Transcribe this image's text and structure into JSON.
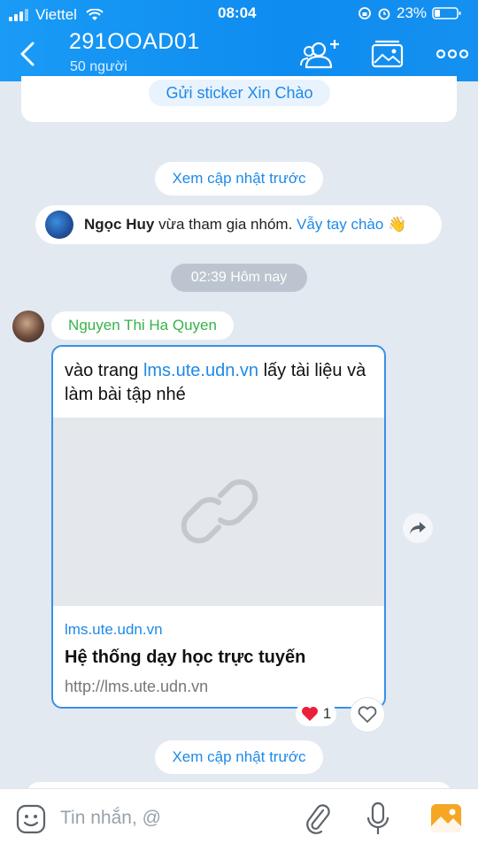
{
  "status_bar": {
    "carrier": "Viettel",
    "time": "08:04",
    "battery": "23%"
  },
  "header": {
    "group_name": "291OOAD01",
    "member_count": "50 người",
    "accent_color": "#0e8cf0"
  },
  "chat": {
    "sticker_button": "Gửi sticker Xin Chào",
    "load_more_top": "Xem cập nhật trước",
    "join_notice": {
      "name": "Ngọc Huy",
      "action": "vừa tham gia nhóm.",
      "wave_label": "Vẫy tay chào",
      "emoji": "👋"
    },
    "time_divider": "02:39 Hôm nay",
    "message": {
      "sender": "Nguyen Thi Ha Quyen",
      "text_before": "vào trang",
      "link_text": "lms.ute.udn.vn",
      "text_after": "lấy tài liệu và làm bài tập nhé",
      "preview": {
        "domain": "lms.ute.udn.vn",
        "title": "Hệ thống dạy học trực tuyến",
        "url": "http://lms.ute.udn.vn"
      },
      "reaction": {
        "emoji": "❤️",
        "count": "1"
      }
    },
    "load_more_bottom": "Xem cập nhật trước"
  },
  "composer": {
    "placeholder": "Tin nhắn, @"
  },
  "icons": [
    "back-icon",
    "add-member-icon",
    "gallery-icon",
    "more-icon",
    "link-icon",
    "share-icon",
    "heart-icon",
    "sticker-icon",
    "attach-icon",
    "mic-icon",
    "photo-icon"
  ]
}
